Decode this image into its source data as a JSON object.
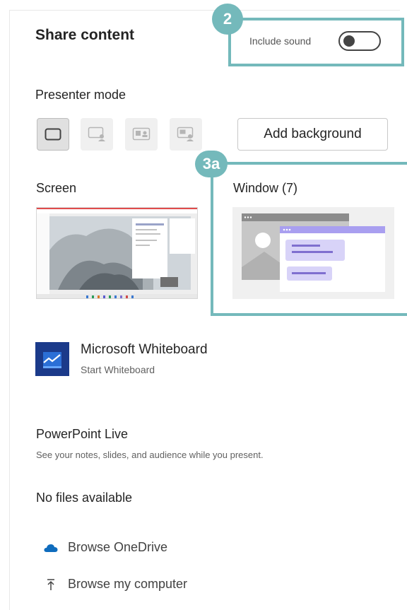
{
  "header": {
    "title": "Share content",
    "include_sound_label": "Include sound",
    "include_sound_on": false
  },
  "callouts": {
    "badge_sound": "2",
    "badge_window": "3a"
  },
  "presenter": {
    "label": "Presenter mode",
    "modes": [
      "content-only",
      "standout",
      "side-by-side",
      "reporter"
    ],
    "selected_index": 0,
    "add_background_label": "Add background"
  },
  "screen": {
    "label": "Screen"
  },
  "window": {
    "label": "Window (7)"
  },
  "whiteboard": {
    "title": "Microsoft Whiteboard",
    "subtitle": "Start Whiteboard"
  },
  "powerpoint": {
    "title": "PowerPoint Live",
    "description": "See your notes, slides, and audience while you present.",
    "empty_text": "No files available"
  },
  "browse": {
    "onedrive_label": "Browse OneDrive",
    "computer_label": "Browse my computer"
  },
  "colors": {
    "callout": "#74b9bb",
    "accent_purple": "#7f6fcf",
    "onedrive_blue": "#0f6cbd"
  }
}
